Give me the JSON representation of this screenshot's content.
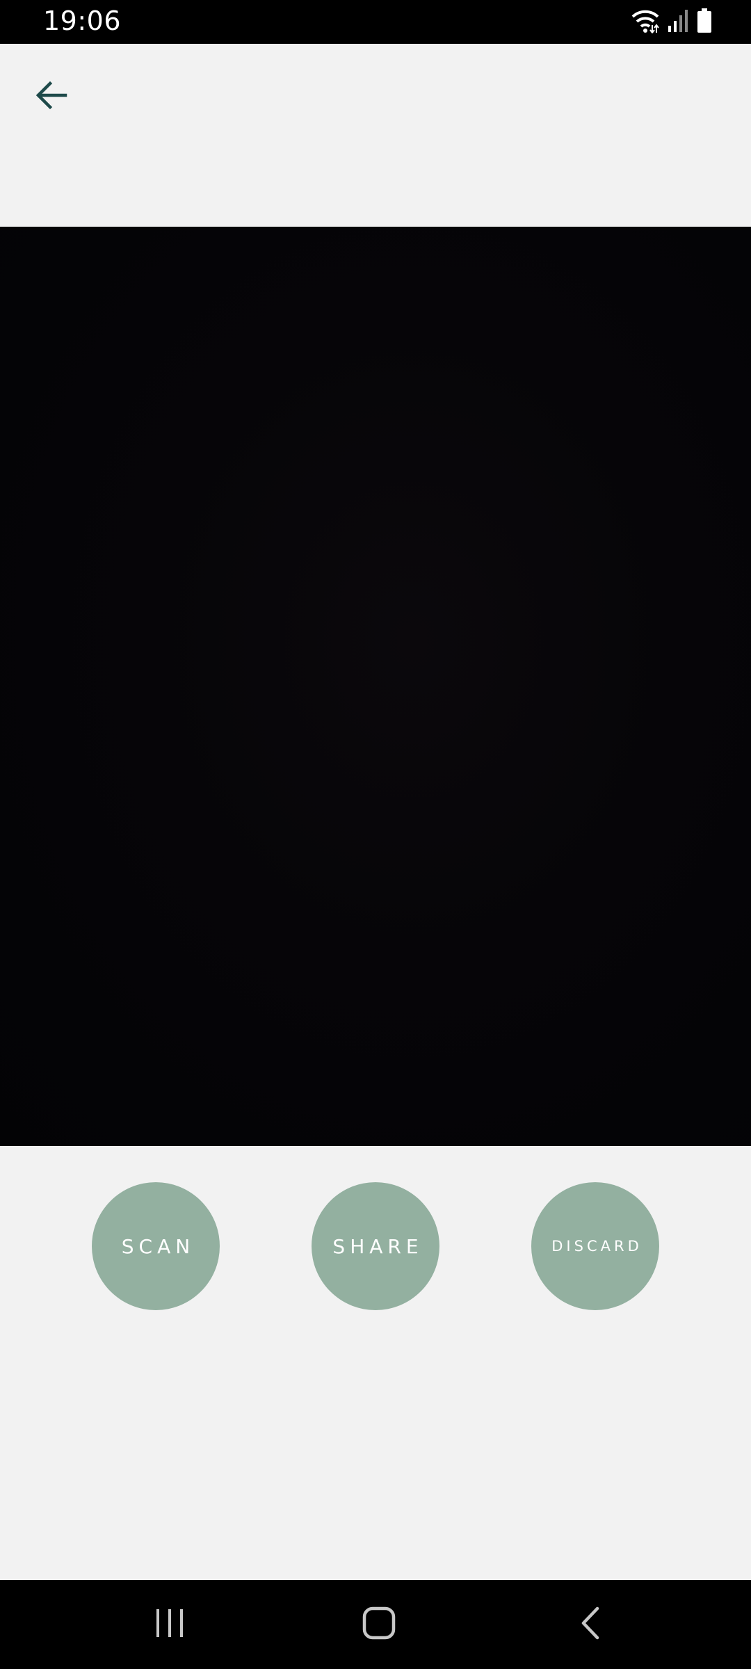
{
  "status_bar": {
    "time": "19:06",
    "icons": [
      "wifi-icon",
      "signal-icon",
      "battery-icon"
    ]
  },
  "app_bar": {
    "back_icon": "arrow-left-icon"
  },
  "actions": {
    "scan_label": "SCAN",
    "share_label": "SHARE",
    "discard_label": "DISCARD"
  },
  "colors": {
    "button_bg": "#93b0a0",
    "button_text": "#ffffff",
    "back_arrow": "#1e4a4a",
    "background": "#f2f2f2",
    "preview_bg": "#050407"
  },
  "nav_bar": {
    "icons": [
      "recents-icon",
      "home-icon",
      "back-icon"
    ]
  }
}
